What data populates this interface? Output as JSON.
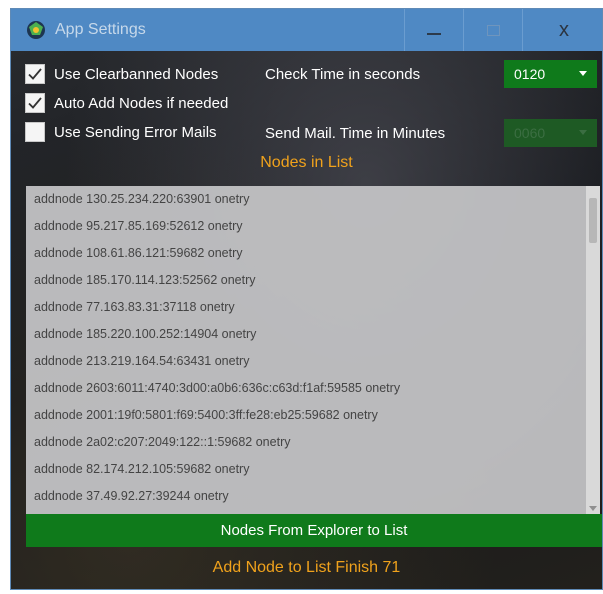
{
  "window": {
    "title": "App Settings",
    "minimize_label": "—",
    "close_label": "x"
  },
  "settings": {
    "use_clearbanned": {
      "label": "Use Clearbanned Nodes",
      "checked": true
    },
    "auto_add": {
      "label": "Auto Add Nodes if needed",
      "checked": true
    },
    "use_error_mails": {
      "label": "Use Sending Error Mails",
      "checked": false
    },
    "check_time": {
      "label": "Check Time in seconds",
      "value": "0120",
      "enabled": true
    },
    "send_mail_time": {
      "label": "Send Mail. Time in Minutes",
      "value": "0060",
      "enabled": false
    }
  },
  "nodes_title": "Nodes in List",
  "nodes": [
    "addnode 130.25.234.220:63901 onetry",
    "addnode 95.217.85.169:52612 onetry",
    "addnode 108.61.86.121:59682 onetry",
    "addnode 185.170.114.123:52562 onetry",
    "addnode 77.163.83.31:37118 onetry",
    "addnode 185.220.100.252:14904 onetry",
    "addnode 213.219.164.54:63431 onetry",
    "addnode 2603:6011:4740:3d00:a0b6:636c:c63d:f1af:59585 onetry",
    "addnode 2001:19f0:5801:f69:5400:3ff:fe28:eb25:59682 onetry",
    "addnode 2a02:c207:2049:122::1:59682 onetry",
    "addnode 82.174.212.105:59682 onetry",
    "addnode 37.49.92.27:39244 onetry"
  ],
  "button_explorer": "Nodes From Explorer to List",
  "status_text": "Add Node to List Finish 71",
  "colors": {
    "titlebar": "#4f89c4",
    "accent_green": "#0f7a1b",
    "accent_orange": "#f0a21c"
  },
  "icons": {
    "app": "app-logo-icon",
    "minimize": "minimize-icon",
    "maximize": "maximize-icon",
    "close": "close-icon",
    "check": "checkmark-icon",
    "dropdown": "chevron-down-icon"
  }
}
